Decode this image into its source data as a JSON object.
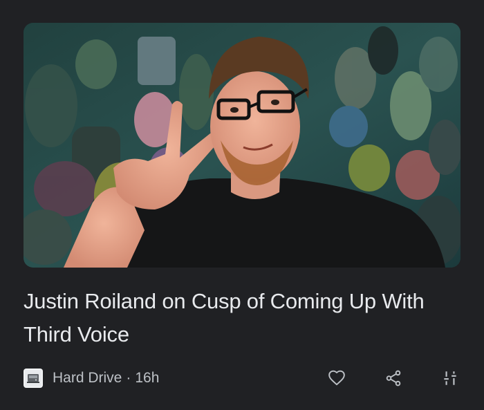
{
  "article": {
    "headline": "Justin Roiland on Cusp of Coming Up With Third Voice",
    "source": "Hard Drive",
    "separator": "·",
    "age": "16h"
  },
  "icons": {
    "source_logo": "hard-drive-logo-icon",
    "like": "heart-icon",
    "share": "share-icon",
    "more": "tune-sliders-icon"
  },
  "colors": {
    "background": "#202124",
    "headline": "#e8eaed",
    "meta": "#bdc1c6"
  }
}
